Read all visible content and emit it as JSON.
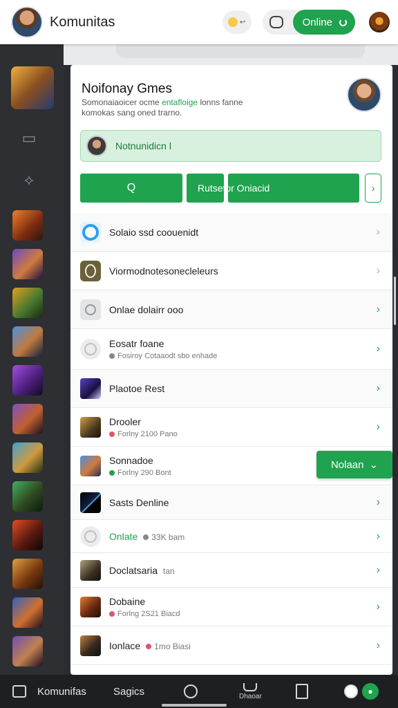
{
  "header": {
    "title": "Komunitas",
    "online_label": "Online"
  },
  "panel": {
    "title": "Noifonay Gmes",
    "desc_part1": "Somonaiaoicer ocme ",
    "desc_green": "entafloige",
    "desc_part2": " lonns fanne komokas sang oned trarno.",
    "banner_text": "Notnunidicn l",
    "actions": {
      "first": "Q",
      "middle": "Rutsetor Oniacid",
      "next": "›"
    }
  },
  "list": [
    {
      "title": "Solaio ssd coouenidt",
      "sub": ""
    },
    {
      "title": "Viormodnotesonecleleurs",
      "sub": ""
    },
    {
      "title": "Onlae dolairr ooo",
      "sub": ""
    },
    {
      "title": "Eosatr foane",
      "sub": "Fosiroy  Cotaaodt sbo enhade"
    },
    {
      "title": "Plaotoe Rest",
      "sub": ""
    },
    {
      "title": "Drooler",
      "sub": "Forlny  2100 Pano"
    },
    {
      "title": "Sonnadoe",
      "sub": "Forlny  290 Bont"
    },
    {
      "title": "Sasts  Denline",
      "sub": ""
    },
    {
      "title": "Onlate",
      "sub": "33K bam"
    },
    {
      "title": "Doclatsaria",
      "sub": "tan"
    },
    {
      "title": "Dobaine",
      "sub": "Forlng  2S21 Biacd"
    },
    {
      "title": "Ionlace",
      "sub": "1mo Biasi"
    }
  ],
  "float_button": "Nolaan",
  "bottom_nav": {
    "community": "Komunifas",
    "sagics": "Sagics",
    "small_label": "Dhaoar"
  },
  "colors": {
    "accent": "#1fa34e",
    "rail": "#2d2f33",
    "panel": "#ffffff"
  },
  "icons": [
    "chat-icon",
    "refresh-icon",
    "chevron-right-icon",
    "chevron-down-icon",
    "home-icon",
    "grid-icon"
  ]
}
